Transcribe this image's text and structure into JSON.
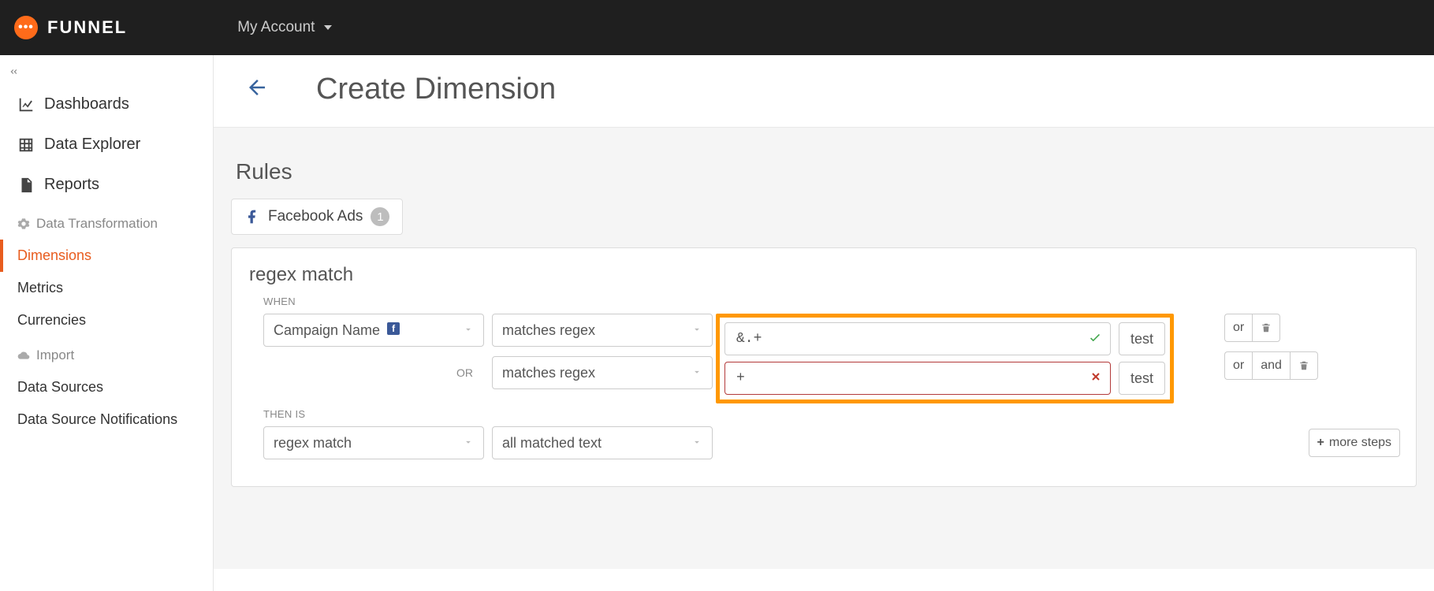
{
  "brand": "FUNNEL",
  "account_label": "My Account",
  "sidebar": {
    "nav": [
      {
        "label": "Dashboards"
      },
      {
        "label": "Data Explorer"
      },
      {
        "label": "Reports"
      }
    ],
    "section_transform": "Data Transformation",
    "transform_items": [
      {
        "label": "Dimensions"
      },
      {
        "label": "Metrics"
      },
      {
        "label": "Currencies"
      }
    ],
    "section_import": "Import",
    "import_items": [
      {
        "label": "Data Sources"
      },
      {
        "label": "Data Source Notifications"
      }
    ]
  },
  "page": {
    "title": "Create Dimension",
    "rules_heading": "Rules",
    "source_chip": {
      "label": "Facebook Ads",
      "count": "1"
    },
    "rule": {
      "title": "regex match",
      "when_label": "WHEN",
      "or_label": "OR",
      "then_label": "THEN IS",
      "field_select": "Campaign Name",
      "operator": "matches regex",
      "value1": "&.+",
      "value2": "+",
      "test_label": "test",
      "or_btn": "or",
      "and_btn": "and",
      "more_steps": "more steps",
      "then_select": "regex match",
      "then_scope": "all matched text"
    }
  }
}
